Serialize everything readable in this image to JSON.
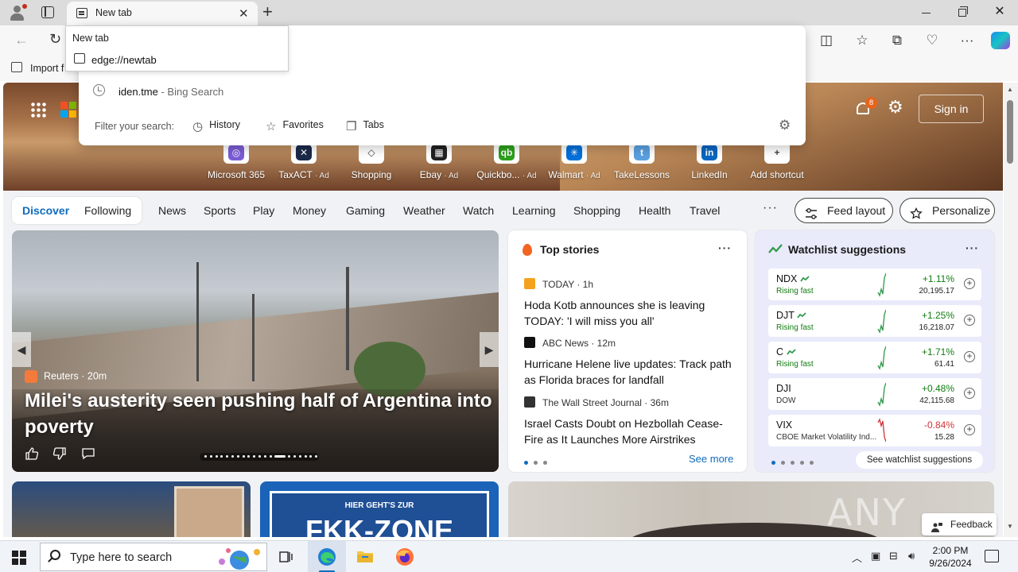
{
  "browser": {
    "tab_title": "New tab",
    "favorites_import": "Import f",
    "omnibox": {
      "tab_label": "New tab",
      "url": "edge://newtab",
      "suggestion_query": "iden.tme",
      "suggestion_source": " - Bing Search",
      "filter_label": "Filter your search:",
      "filters": [
        "History",
        "Favorites",
        "Tabs"
      ]
    }
  },
  "header": {
    "notification_count": "8",
    "sign_in": "Sign in"
  },
  "shortcuts": [
    {
      "label": "Microsoft 365",
      "ad": "",
      "color": "#7b5cd6",
      "glyph": "◎"
    },
    {
      "label": "TaxACT",
      "ad": "· Ad",
      "color": "#1c2a4a",
      "glyph": "✕"
    },
    {
      "label": "Shopping",
      "ad": "",
      "color": "#ffffff",
      "glyph": "◇"
    },
    {
      "label": "Ebay",
      "ad": "· Ad",
      "color": "#222222",
      "glyph": "▦"
    },
    {
      "label": "Quickbo...",
      "ad": "· Ad",
      "color": "#2ca01c",
      "glyph": "qb"
    },
    {
      "label": "Walmart",
      "ad": "· Ad",
      "color": "#0071dc",
      "glyph": "✳"
    },
    {
      "label": "TakeLessons",
      "ad": "",
      "color": "#5aa0e0",
      "glyph": "t"
    },
    {
      "label": "LinkedIn",
      "ad": "",
      "color": "#0a66c2",
      "glyph": "in"
    },
    {
      "label": "Add shortcut",
      "ad": "",
      "color": "#ffffff",
      "glyph": "+"
    }
  ],
  "nav": {
    "pills": [
      "Discover",
      "Following"
    ],
    "links": [
      "News",
      "Sports",
      "Play",
      "Money",
      "Gaming",
      "Weather",
      "Watch",
      "Learning",
      "Shopping",
      "Health",
      "Travel"
    ],
    "more": "···",
    "feed_layout": "Feed layout",
    "personalize": "Personalize"
  },
  "hero": {
    "source": "Reuters · 20m",
    "headline": "Milei's austerity seen pushing half of Argentina into poverty"
  },
  "top_stories": {
    "title": "Top stories",
    "items": [
      {
        "source": "TODAY · 1h",
        "headline": "Hoda Kotb announces she is leaving TODAY: 'I will miss you all'",
        "icon_color": "#f4a21e"
      },
      {
        "source": "ABC News · 12m",
        "headline": "Hurricane Helene live updates: Track path as Florida braces for landfall",
        "icon_color": "#111111"
      },
      {
        "source": "The Wall Street Journal · 36m",
        "headline": "Israel Casts Doubt on Hezbollah Cease-Fire as It Launches More Airstrikes",
        "icon_color": "#333333"
      }
    ],
    "see_more": "See more"
  },
  "watchlist": {
    "title": "Watchlist suggestions",
    "items": [
      {
        "symbol": "NDX",
        "sub": "Rising fast",
        "change": "+1.11%",
        "value": "20,195.17",
        "up": true,
        "trend": true
      },
      {
        "symbol": "DJT",
        "sub": "Rising fast",
        "change": "+1.25%",
        "value": "16,218.07",
        "up": true,
        "trend": true
      },
      {
        "symbol": "C",
        "sub": "Rising fast",
        "change": "+1.71%",
        "value": "61.41",
        "up": true,
        "trend": true
      },
      {
        "symbol": "DJI",
        "sub": "DOW",
        "change": "+0.48%",
        "value": "42,115.68",
        "up": true,
        "trend": false
      },
      {
        "symbol": "VIX",
        "sub": "CBOE Market Volatility Ind...",
        "change": "-0.84%",
        "value": "15.28",
        "up": false,
        "trend": false
      }
    ],
    "see_all": "See watchlist suggestions"
  },
  "cards": {
    "fkk_line1": "HIER GEHT'S ZUR",
    "fkk_line2": "FKK-ZONE"
  },
  "feedback": "Feedback",
  "watermark": "ANY RUN",
  "taskbar": {
    "search_placeholder": "Type here to search",
    "time": "2:00 PM",
    "date": "9/26/2024"
  },
  "colors": {
    "accent": "#0f6cbd",
    "positive": "#107c10",
    "negative": "#d13438"
  }
}
